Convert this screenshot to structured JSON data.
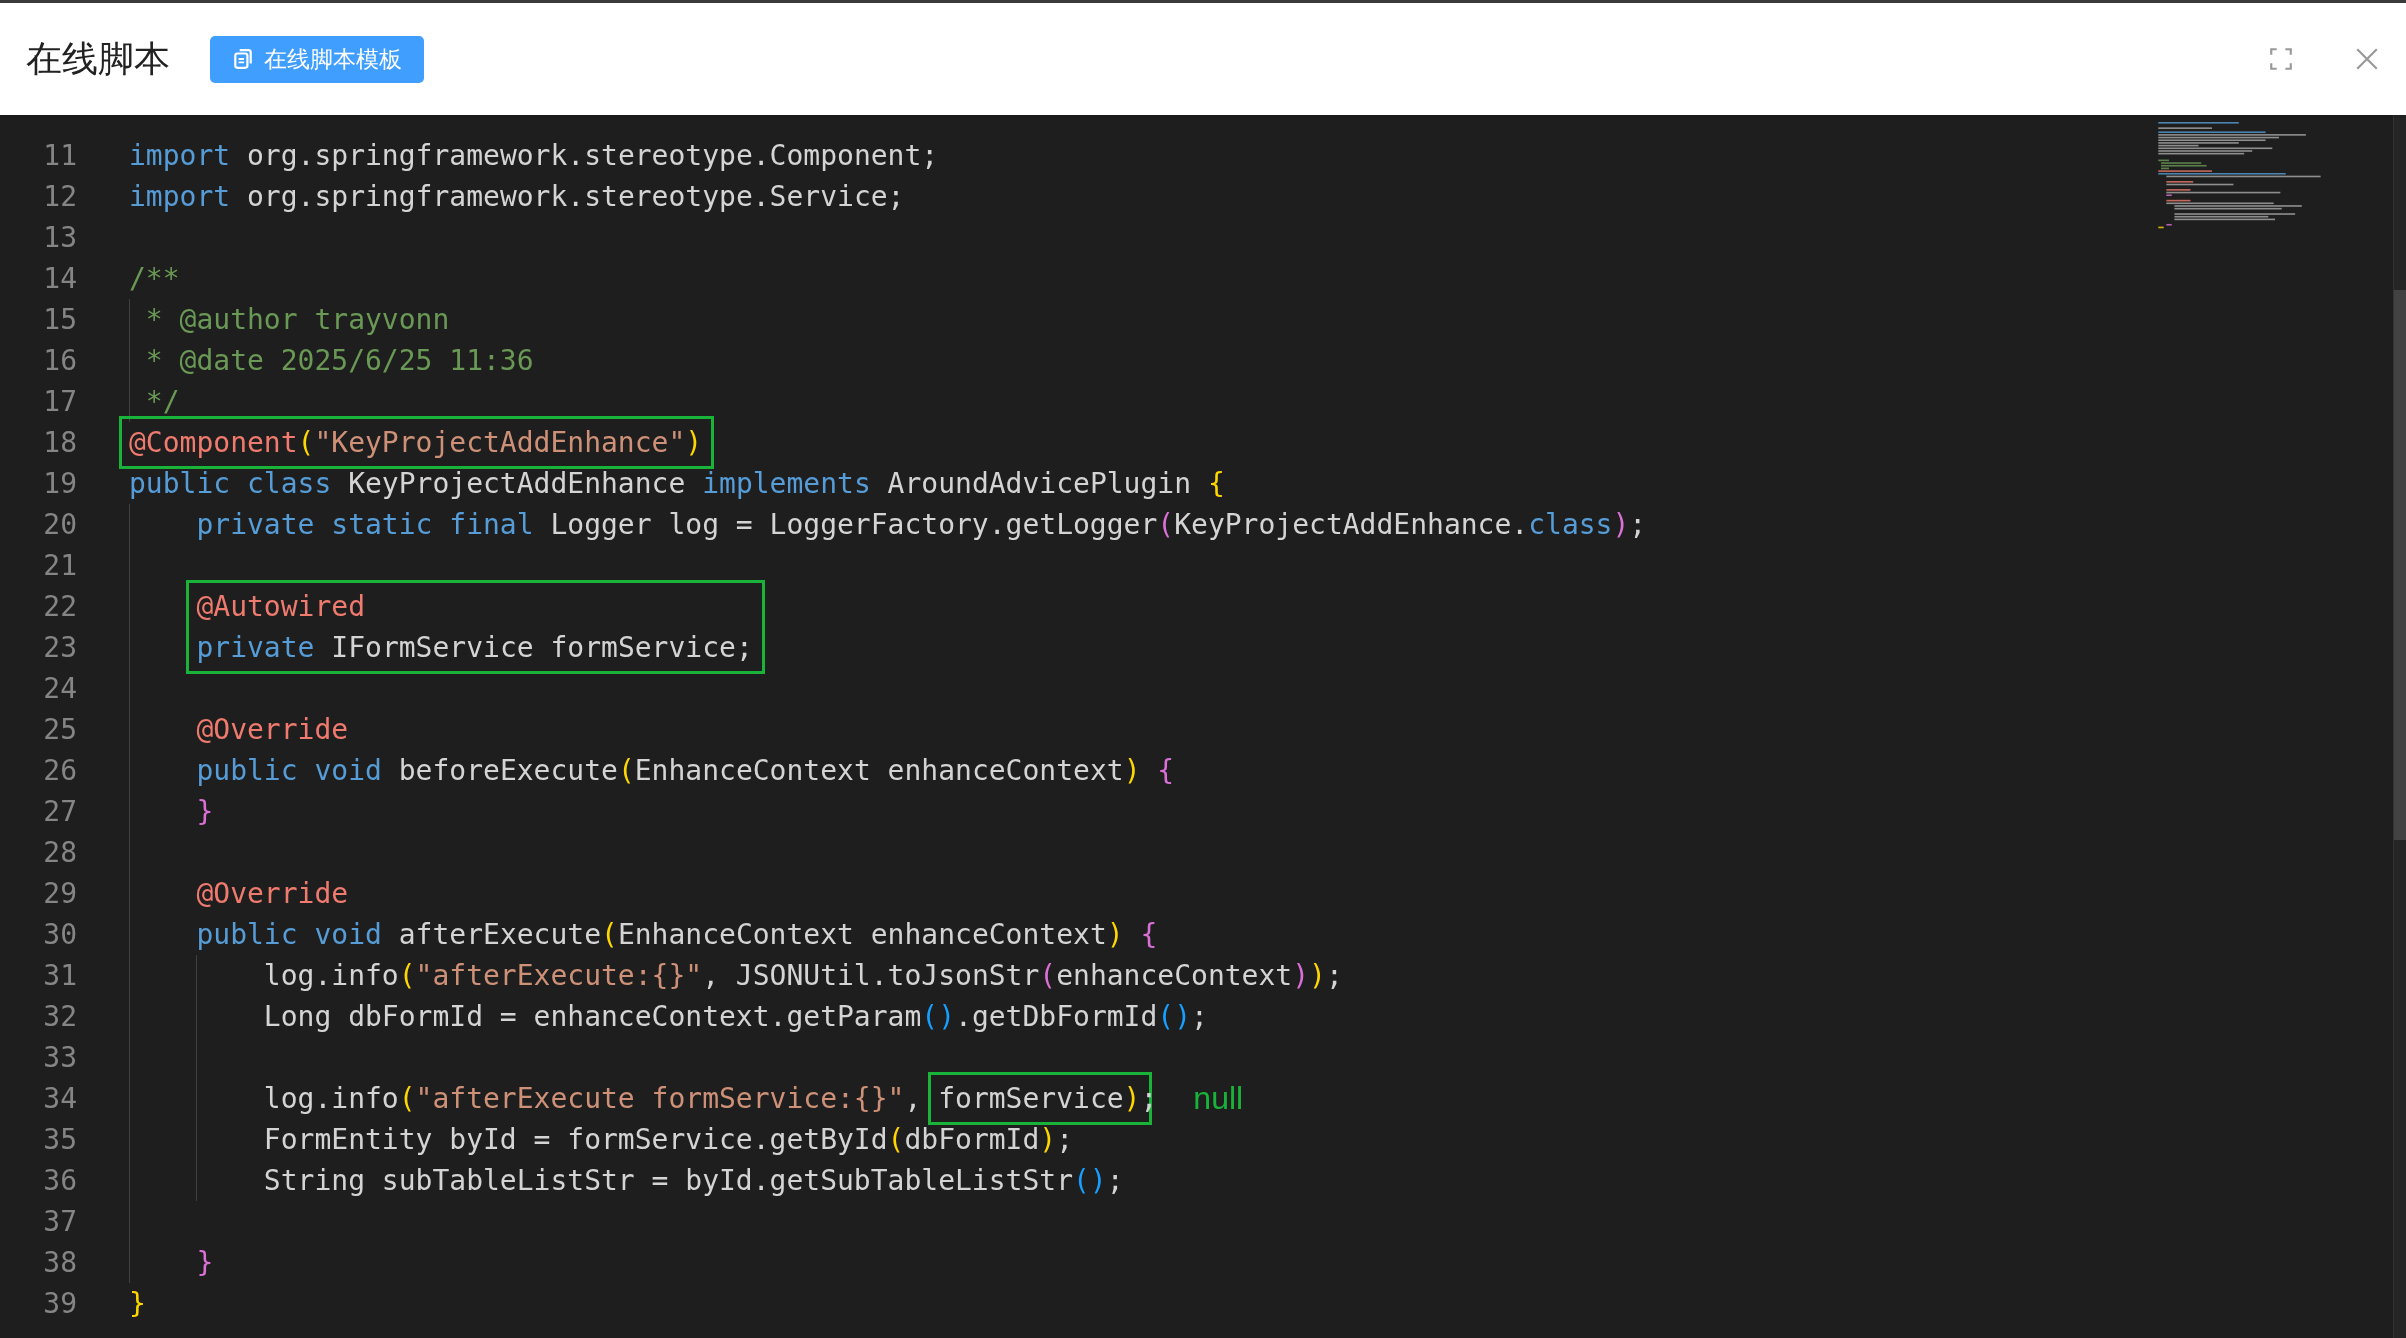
{
  "dialog": {
    "title": "在线脚本",
    "template_button": "在线脚本模板"
  },
  "editor": {
    "lines": [
      {
        "n": "11",
        "tokens": [
          {
            "t": "import",
            "kind": "kw"
          },
          {
            "t": " org.springframework.stereotype.Component;"
          }
        ]
      },
      {
        "n": "12",
        "tokens": [
          {
            "t": "import",
            "kind": "kw"
          },
          {
            "t": " org.springframework.stereotype.Service;"
          }
        ]
      },
      {
        "n": "13"
      },
      {
        "n": "14",
        "tokens": [
          {
            "t": "/**",
            "kind": "comment"
          }
        ]
      },
      {
        "n": "15",
        "tokens": [
          {
            "t": " * @author trayvonn",
            "kind": "comment"
          }
        ]
      },
      {
        "n": "16",
        "tokens": [
          {
            "t": " * @date 2025/6/25 11:36",
            "kind": "comment"
          }
        ]
      },
      {
        "n": "17",
        "tokens": [
          {
            "t": " */",
            "kind": "comment"
          }
        ]
      },
      {
        "n": "18",
        "tokens": [
          {
            "t": "@Component",
            "kind": "anno",
            "box": true
          },
          {
            "t": "(",
            "kind": "b1",
            "box": true
          },
          {
            "t": "\"KeyProjectAddEnhance\"",
            "kind": "str",
            "box": true
          },
          {
            "t": ")",
            "kind": "b1",
            "box": true
          }
        ]
      },
      {
        "n": "19",
        "tokens": [
          {
            "t": "public class",
            "kind": "kw"
          },
          {
            "t": " KeyProjectAddEnhance "
          },
          {
            "t": "implements",
            "kind": "kw"
          },
          {
            "t": " AroundAdvicePlugin "
          },
          {
            "t": "{",
            "kind": "b1"
          }
        ]
      },
      {
        "n": "20",
        "tokens": [
          {
            "t": "    private static final",
            "kind": "kw"
          },
          {
            "t": " Logger log = LoggerFactory.getLogger"
          },
          {
            "t": "(",
            "kind": "b2"
          },
          {
            "t": "KeyProjectAddEnhance."
          },
          {
            "t": "class",
            "kind": "kw"
          },
          {
            "t": ")",
            "kind": "b2"
          },
          {
            "t": ";"
          }
        ]
      },
      {
        "n": "21"
      },
      {
        "n": "22",
        "tokens": [
          {
            "t": "    @Autowired",
            "kind": "anno",
            "box": true
          }
        ]
      },
      {
        "n": "23",
        "tokens": [
          {
            "t": "    private",
            "kind": "kw",
            "box": true
          },
          {
            "t": " IFormService formService;",
            "box": true
          }
        ]
      },
      {
        "n": "24"
      },
      {
        "n": "25",
        "tokens": [
          {
            "t": "    @Override",
            "kind": "anno"
          }
        ]
      },
      {
        "n": "26",
        "tokens": [
          {
            "t": "    public void",
            "kind": "kw"
          },
          {
            "t": " beforeExecute"
          },
          {
            "t": "(",
            "kind": "b1"
          },
          {
            "t": "EnhanceContext enhanceContext"
          },
          {
            "t": ")",
            "kind": "b1"
          },
          {
            "t": " {",
            "kind": "b2"
          }
        ]
      },
      {
        "n": "27",
        "tokens": [
          {
            "t": "    }",
            "kind": "b2"
          }
        ]
      },
      {
        "n": "28"
      },
      {
        "n": "29",
        "tokens": [
          {
            "t": "    @Override",
            "kind": "anno"
          }
        ]
      },
      {
        "n": "30",
        "tokens": [
          {
            "t": "    public void",
            "kind": "kw"
          },
          {
            "t": " afterExecute"
          },
          {
            "t": "(",
            "kind": "b1"
          },
          {
            "t": "EnhanceContext enhanceContext"
          },
          {
            "t": ")",
            "kind": "b1"
          },
          {
            "t": " {",
            "kind": "b2"
          }
        ]
      },
      {
        "n": "31",
        "tokens": [
          {
            "t": "        log.info"
          },
          {
            "t": "(",
            "kind": "b1"
          },
          {
            "t": "\"afterExecute:{}\"",
            "kind": "str"
          },
          {
            "t": ", JSONUtil.toJsonStr"
          },
          {
            "t": "(",
            "kind": "b2"
          },
          {
            "t": "enhanceContext"
          },
          {
            "t": ")",
            "kind": "b2"
          },
          {
            "t": ")",
            "kind": "b1"
          },
          {
            "t": ";"
          }
        ]
      },
      {
        "n": "32",
        "tokens": [
          {
            "t": "        Long dbFormId = enhanceContext.getParam"
          },
          {
            "t": "()",
            "kind": "b3"
          },
          {
            "t": ".getDbFormId"
          },
          {
            "t": "()",
            "kind": "b3"
          },
          {
            "t": ";"
          }
        ]
      },
      {
        "n": "33"
      },
      {
        "n": "34",
        "tokens": [
          {
            "t": "        log.info"
          },
          {
            "t": "(",
            "kind": "b1"
          },
          {
            "t": "\"afterExecute formService:{}\"",
            "kind": "str"
          },
          {
            "t": ","
          },
          {
            "t": " formService",
            "box": true
          },
          {
            "t": ")",
            "kind": "b1",
            "box": true
          },
          {
            "t": ";"
          }
        ],
        "note": "null"
      },
      {
        "n": "35",
        "tokens": [
          {
            "t": "        FormEntity byId = formService.getById"
          },
          {
            "t": "(",
            "kind": "b1"
          },
          {
            "t": "dbFormId"
          },
          {
            "t": ")",
            "kind": "b1"
          },
          {
            "t": ";"
          }
        ]
      },
      {
        "n": "36",
        "tokens": [
          {
            "t": "        String subTableListStr = byId.getSubTableListStr"
          },
          {
            "t": "()",
            "kind": "b3"
          },
          {
            "t": ";"
          }
        ]
      },
      {
        "n": "37"
      },
      {
        "n": "38",
        "tokens": [
          {
            "t": "    }",
            "kind": "b2"
          }
        ]
      },
      {
        "n": "39",
        "tokens": [
          {
            "t": "}",
            "kind": "b1"
          }
        ]
      }
    ]
  }
}
